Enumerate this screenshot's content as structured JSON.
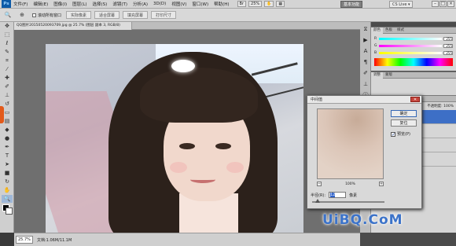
{
  "menubar": {
    "logo": "Ps",
    "items": [
      "文件(F)",
      "编辑(E)",
      "图像(I)",
      "图层(L)",
      "选择(S)",
      "滤镜(T)",
      "分析(A)",
      "3D(D)",
      "视图(V)",
      "窗口(W)",
      "帮助(H)"
    ],
    "zoom_select": "25%",
    "workspace": "基本功能",
    "cs_live": "CS Live ▾"
  },
  "options": {
    "checkbox_label": "滚动所有窗口",
    "buttons": [
      "实际像素",
      "适合屏幕",
      "填充屏幕",
      "打印尺寸"
    ]
  },
  "document": {
    "tab_title": "QQ图片20150520093709.jpg @ 25.7% (图层 副本 3, RGB/8)",
    "zoom": "25.7%",
    "doc_info": "文档:1.06M/11.1M"
  },
  "panels": {
    "color_tabs": [
      "颜色",
      "色板",
      "样式"
    ],
    "sliders": [
      {
        "label": "R",
        "value": "255",
        "color": "#e06060"
      },
      {
        "label": "G",
        "value": "255",
        "color": "#6acd6a"
      },
      {
        "label": "B",
        "value": "255",
        "color": "#6a8fe0"
      }
    ],
    "adjust_tabs": [
      "调整",
      "蒙版"
    ],
    "layer_tabs": [
      "图层",
      "通道",
      "路径"
    ],
    "blend_mode": "正常",
    "opacity_label": "不透明度: 100%",
    "layers": [
      "图层 副本 3",
      "图层 副本 2",
      "图层 副本",
      "背景"
    ]
  },
  "dialog": {
    "title": "中间值",
    "ok": "确定",
    "reset": "复位",
    "preview_label": "预览(P)",
    "preview_checked": "✓",
    "zoom_value": "100%",
    "zoom_minus": "−",
    "zoom_plus": "+",
    "radius_label": "半径(R):",
    "radius_value": "12",
    "radius_unit": "像素"
  },
  "watermark": "UiBQ.CoM"
}
